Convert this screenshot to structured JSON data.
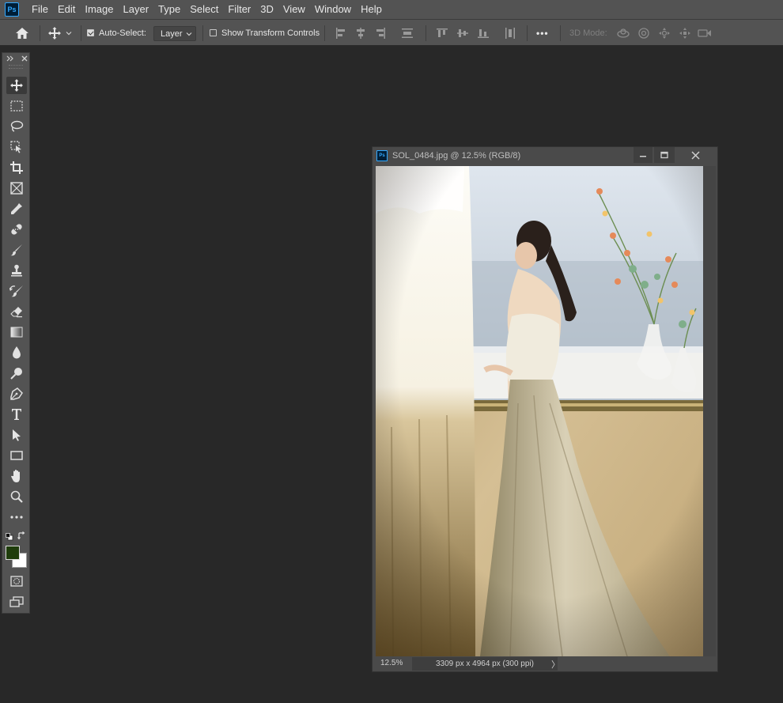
{
  "menu": {
    "logo": "Ps",
    "items": [
      "File",
      "Edit",
      "Image",
      "Layer",
      "Type",
      "Select",
      "Filter",
      "3D",
      "View",
      "Window",
      "Help"
    ]
  },
  "options": {
    "auto_select_label": "Auto-Select:",
    "auto_select_checked": true,
    "auto_select_target": "Layer",
    "show_transform_label": "Show Transform Controls",
    "show_transform_checked": false,
    "mode_3d_label": "3D Mode:",
    "more_label": "•••"
  },
  "tools": [
    {
      "name": "move-tool",
      "icon": "move-icon",
      "active": true
    },
    {
      "name": "marquee-tool",
      "icon": "rectangular-marquee-icon"
    },
    {
      "name": "lasso-tool",
      "icon": "lasso-icon"
    },
    {
      "name": "object-selection-tool",
      "icon": "object-selection-icon"
    },
    {
      "name": "crop-tool",
      "icon": "crop-icon"
    },
    {
      "name": "frame-tool",
      "icon": "frame-icon"
    },
    {
      "name": "eyedropper-tool",
      "icon": "eyedropper-icon"
    },
    {
      "name": "healing-brush-tool",
      "icon": "bandage-icon"
    },
    {
      "name": "brush-tool",
      "icon": "brush-icon"
    },
    {
      "name": "clone-stamp-tool",
      "icon": "stamp-icon"
    },
    {
      "name": "history-brush-tool",
      "icon": "history-brush-icon"
    },
    {
      "name": "eraser-tool",
      "icon": "eraser-icon"
    },
    {
      "name": "gradient-tool",
      "icon": "gradient-icon"
    },
    {
      "name": "blur-tool",
      "icon": "drop-icon"
    },
    {
      "name": "dodge-tool",
      "icon": "dodge-icon"
    },
    {
      "name": "pen-tool",
      "icon": "pen-icon"
    },
    {
      "name": "type-tool",
      "icon": "type-icon"
    },
    {
      "name": "path-selection-tool",
      "icon": "arrow-icon"
    },
    {
      "name": "rectangle-tool",
      "icon": "rectangle-icon"
    },
    {
      "name": "hand-tool",
      "icon": "hand-icon"
    },
    {
      "name": "zoom-tool",
      "icon": "zoom-icon"
    },
    {
      "name": "edit-toolbar",
      "icon": "more-icon"
    }
  ],
  "colors": {
    "foreground": "#1f3d0c",
    "background": "#ffffff"
  },
  "document": {
    "title": "SOL_0484.jpg @ 12.5% (RGB/8)",
    "zoom": "12.5%",
    "info": "3309 px x 4964 px (300 ppi)",
    "status_arrow": "〉"
  }
}
